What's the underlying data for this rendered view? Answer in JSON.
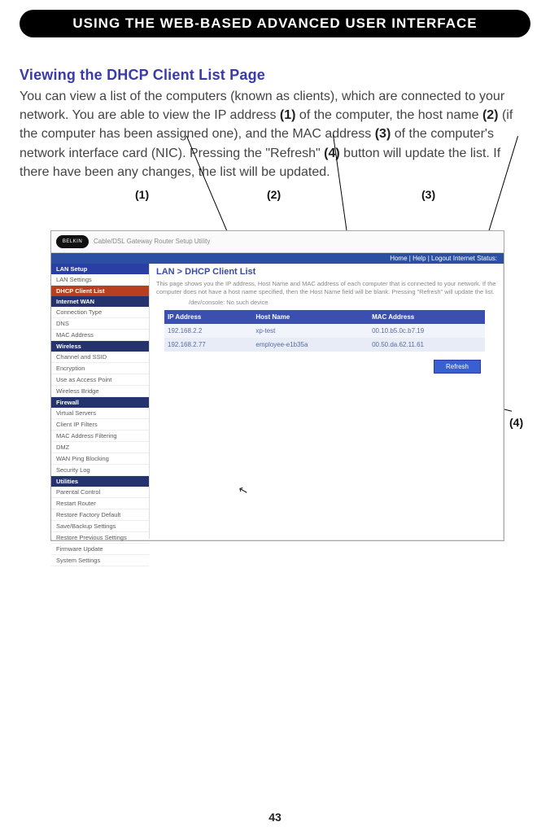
{
  "header": {
    "title": "USING THE WEB-BASED ADVANCED USER INTERFACE"
  },
  "section": {
    "title": "Viewing the DHCP Client List Page"
  },
  "body": {
    "p1a": "You can view a list of the computers (known as clients), which are connected to your network. You are able to view the IP address ",
    "b1": "(1)",
    "p1b": " of the computer, the host name ",
    "b2": "(2)",
    "p1c": " (if the computer has been assigned one), and the MAC address ",
    "b3": "(3)",
    "p1d": " of the computer's network interface card (NIC). Pressing the \"Refresh\" ",
    "b4": "(4)",
    "p1e": " button will update the list. If there have been any changes, the list will be updated."
  },
  "callouts": {
    "c1": "(1)",
    "c2": "(2)",
    "c3": "(3)",
    "c4": "(4)"
  },
  "shot": {
    "logo": "BELKIN",
    "util_title": "Cable/DSL Gateway Router Setup Utility",
    "bluebar": "Home | Help | Logout   Internet Status:",
    "breadcrumb": "LAN > DHCP Client List",
    "desc1": "This page shows you the IP address, Host Name and MAC address of each computer that is connected to your network. If the computer does not have a host name specified, then the Host Name field will be blank. Pressing \"Refresh\" will update the list.",
    "desc2": "/dev/console: No such device",
    "headers": {
      "ip": "IP Address",
      "host": "Host Name",
      "mac": "MAC Address"
    },
    "rows": [
      {
        "ip": "192.168.2.2",
        "host": "xp-test",
        "mac": "00.10.b5.0c.b7.19"
      },
      {
        "ip": "192.168.2.77",
        "host": "employee-e1b35a",
        "mac": "00.50.da.62.11.61"
      }
    ],
    "refresh": "Refresh",
    "sidebar": {
      "lan_setup": "LAN Setup",
      "lan_items": [
        "LAN Settings"
      ],
      "dhcp_active": "DHCP Client List",
      "wan": "Internet WAN",
      "wan_items": [
        "Connection Type",
        "DNS",
        "MAC Address"
      ],
      "wireless": "Wireless",
      "wireless_items": [
        "Channel and SSID",
        "Encryption",
        "Use as Access Point",
        "Wireless Bridge"
      ],
      "firewall": "Firewall",
      "firewall_items": [
        "Virtual Servers",
        "Client IP Filters",
        "MAC Address Filtering",
        "DMZ",
        "WAN Ping Blocking",
        "Security Log"
      ],
      "utilities": "Utilities",
      "util_items": [
        "Parental Control",
        "Restart Router",
        "Restore Factory Default",
        "Save/Backup Settings",
        "Restore Previous Settings",
        "Firmware Update",
        "System Settings"
      ]
    }
  },
  "page_number": "43"
}
